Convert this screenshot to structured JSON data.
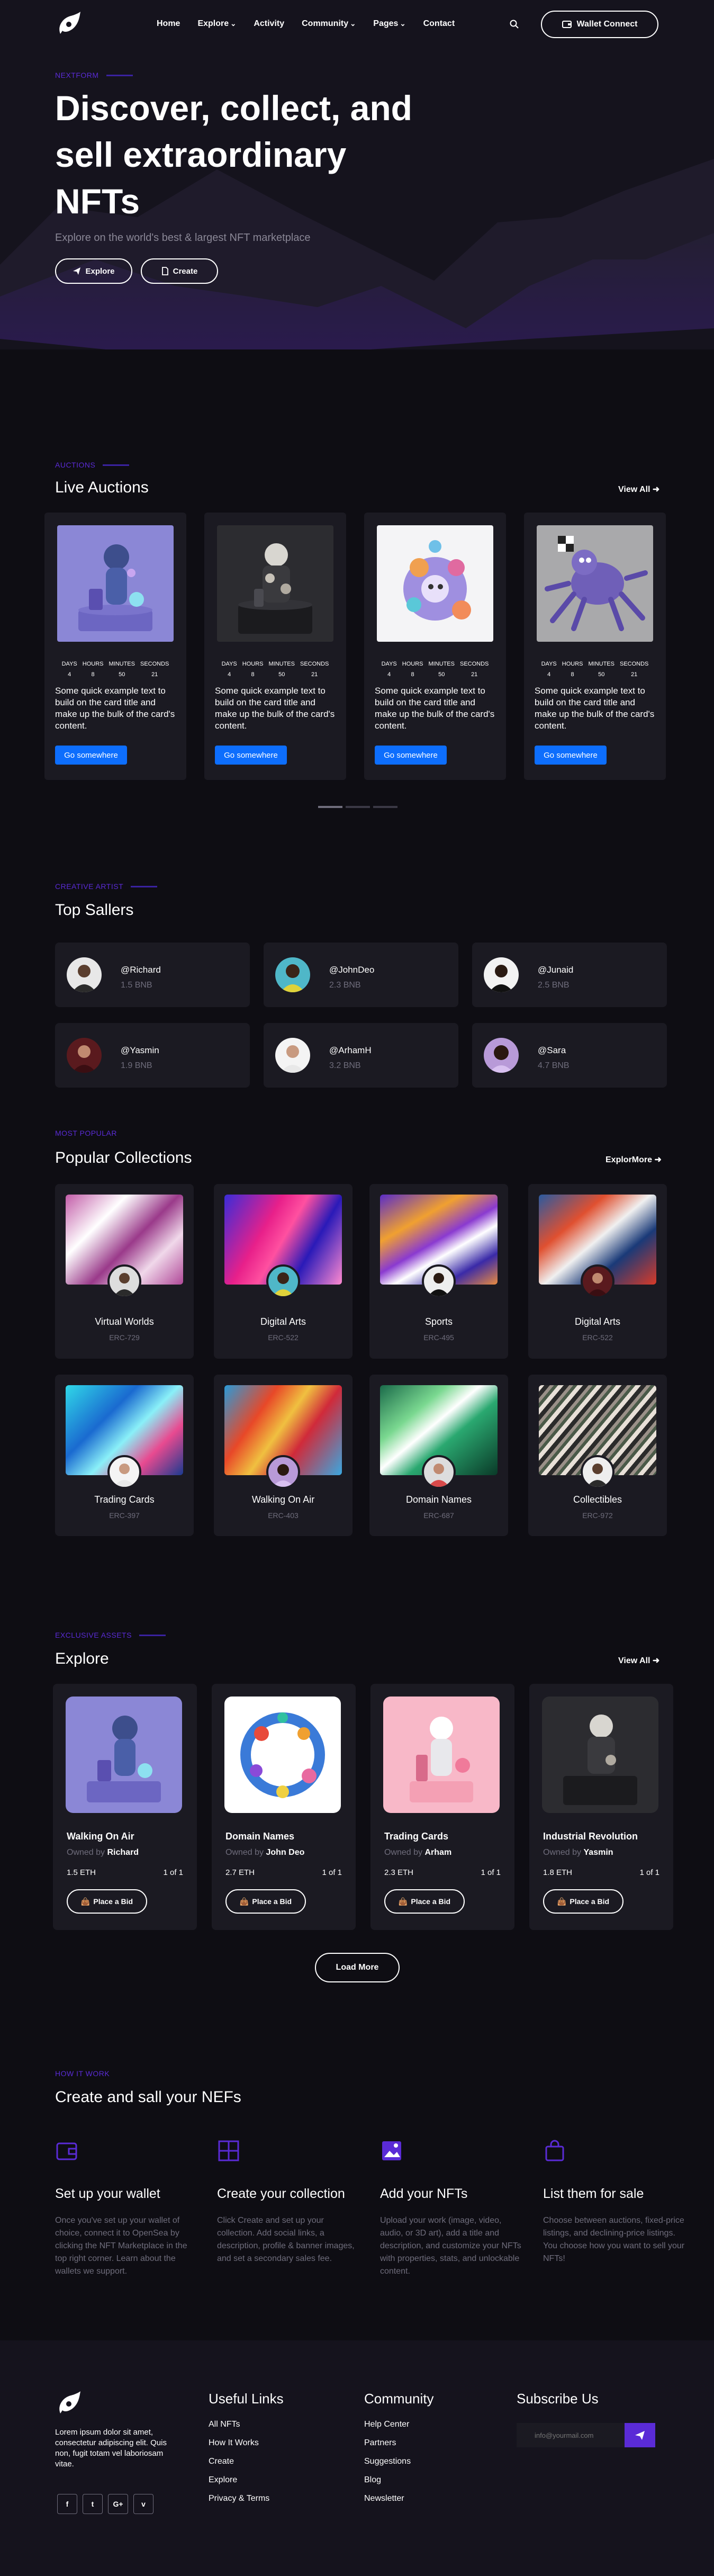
{
  "nav": {
    "links": [
      "Home",
      "Explore",
      "Activity",
      "Community",
      "Pages",
      "Contact"
    ],
    "wallet_label": "Wallet Connect"
  },
  "hero": {
    "eyebrow": "NEXTFORM",
    "title": "Discover, collect, and sell extraordinary NFTs",
    "subtitle": "Explore on the world's best & largest NFT marketplace",
    "explore_label": "Explore",
    "create_label": "Create"
  },
  "auctions": {
    "eyebrow": "AUCTIONS",
    "title": "Live Auctions",
    "view_all": "View All",
    "timer_labels": [
      "DAYS",
      "HOURS",
      "MINUTES",
      "SECONDS"
    ],
    "timer_values": [
      "4",
      "8",
      "50",
      "21"
    ],
    "card_text": "Some quick example text to build on the card title and make up the bulk of the card's content.",
    "button_label": "Go somewhere",
    "count": 4
  },
  "sellers": {
    "eyebrow": "CREATIVE ARTIST",
    "title": "Top Sallers",
    "items": [
      {
        "name": "@Richard",
        "value": "1.5 BNB"
      },
      {
        "name": "@JohnDeo",
        "value": "2.3 BNB"
      },
      {
        "name": "@Junaid",
        "value": "2.5 BNB"
      },
      {
        "name": "@Yasmin",
        "value": "1.9 BNB"
      },
      {
        "name": "@ArhamH",
        "value": "3.2 BNB"
      },
      {
        "name": "@Sara",
        "value": "4.7 BNB"
      }
    ]
  },
  "collections": {
    "eyebrow": "MOST POPULAR",
    "title": "Popular Collections",
    "explore_more": "ExplorMore",
    "items": [
      {
        "title": "Virtual Worlds",
        "sub": "ERC-729"
      },
      {
        "title": "Digital Arts",
        "sub": "ERC-522"
      },
      {
        "title": "Sports",
        "sub": "ERC-495"
      },
      {
        "title": "Digital Arts",
        "sub": "ERC-522"
      },
      {
        "title": "Trading Cards",
        "sub": "ERC-397"
      },
      {
        "title": "Walking On Air",
        "sub": "ERC-403"
      },
      {
        "title": "Domain Names",
        "sub": "ERC-687"
      },
      {
        "title": "Collectibles",
        "sub": "ERC-972"
      }
    ]
  },
  "explore": {
    "eyebrow": "EXCLUSIVE ASSETS",
    "title": "Explore",
    "view_all": "View All",
    "owned_by": "Owned by",
    "bid_label": "Place a Bid",
    "load_more": "Load More",
    "items": [
      {
        "title": "Walking On Air",
        "owner": "Richard",
        "price": "1.5 ETH",
        "of": "1 of 1"
      },
      {
        "title": "Domain Names",
        "owner": "John Deo",
        "price": "2.7 ETH",
        "of": "1 of 1"
      },
      {
        "title": "Trading Cards",
        "owner": "Arham",
        "price": "2.3 ETH",
        "of": "1 of 1"
      },
      {
        "title": "Industrial Revolution",
        "owner": "Yasmin",
        "price": "1.8 ETH",
        "of": "1 of 1"
      }
    ]
  },
  "how": {
    "eyebrow": "HOW IT WORK",
    "title": "Create and sall your NEFs",
    "steps": [
      {
        "title": "Set up your wallet",
        "text": "Once you've set up your wallet of choice, connect it to OpenSea by clicking the NFT Marketplace in the top right corner. Learn about the wallets we support."
      },
      {
        "title": "Create your collection",
        "text": "Click Create and set up your collection. Add social links, a description, profile & banner images, and set a secondary sales fee."
      },
      {
        "title": "Add your NFTs",
        "text": "Upload your work (image, video, audio, or 3D art), add a title and description, and customize your NFTs with properties, stats, and unlockable content."
      },
      {
        "title": "List them for sale",
        "text": "Choose between auctions, fixed-price listings, and declining-price listings. You choose how you want to sell your NFTs!"
      }
    ]
  },
  "footer": {
    "about": "Lorem ipsum dolor sit amet, consectetur adipiscing elit. Quis non, fugit totam vel laboriosam vitae.",
    "useful_title": "Useful Links",
    "useful_links": [
      "All NFTs",
      "How It Works",
      "Create",
      "Explore",
      "Privacy & Terms"
    ],
    "community_title": "Community",
    "community_links": [
      "Help Center",
      "Partners",
      "Suggestions",
      "Blog",
      "Newsletter"
    ],
    "subscribe_title": "Subscribe Us",
    "email_placeholder": "info@yourmail.com",
    "social": [
      "f",
      "t",
      "G+",
      "v"
    ]
  },
  "colors": {
    "accent": "#5a2bd6",
    "button_blue": "#0d6efd",
    "background": "#0e0d13",
    "card": "#1b1a22"
  }
}
